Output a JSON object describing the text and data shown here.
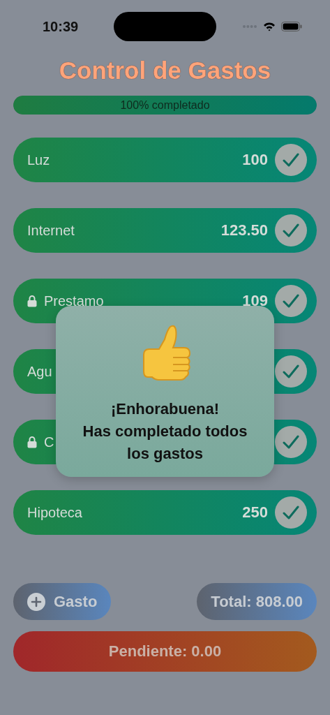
{
  "status_bar": {
    "time": "10:39"
  },
  "title": "Control de Gastos",
  "progress": {
    "label": "100% completado",
    "level": 1
  },
  "expenses": [
    {
      "name": "Luz",
      "amount": "100",
      "locked": false,
      "checked": true
    },
    {
      "name": "Internet",
      "amount": "123.50",
      "locked": false,
      "checked": true
    },
    {
      "name": "Prestamo",
      "amount": "109",
      "locked": true,
      "checked": true
    },
    {
      "name": "Agu",
      "locked": false,
      "checked": true
    },
    {
      "name": "C",
      "locked": true,
      "checked": true
    },
    {
      "name": "Hipoteca",
      "amount": "250",
      "locked": false,
      "checked": true
    }
  ],
  "dialog": {
    "title": "¡Enhorabuena!",
    "message": "Has completado todos los gastos"
  },
  "add_button": {
    "label": "Gasto"
  },
  "total": "Total: 808.00",
  "pending": "Pendiente: 0.00"
}
